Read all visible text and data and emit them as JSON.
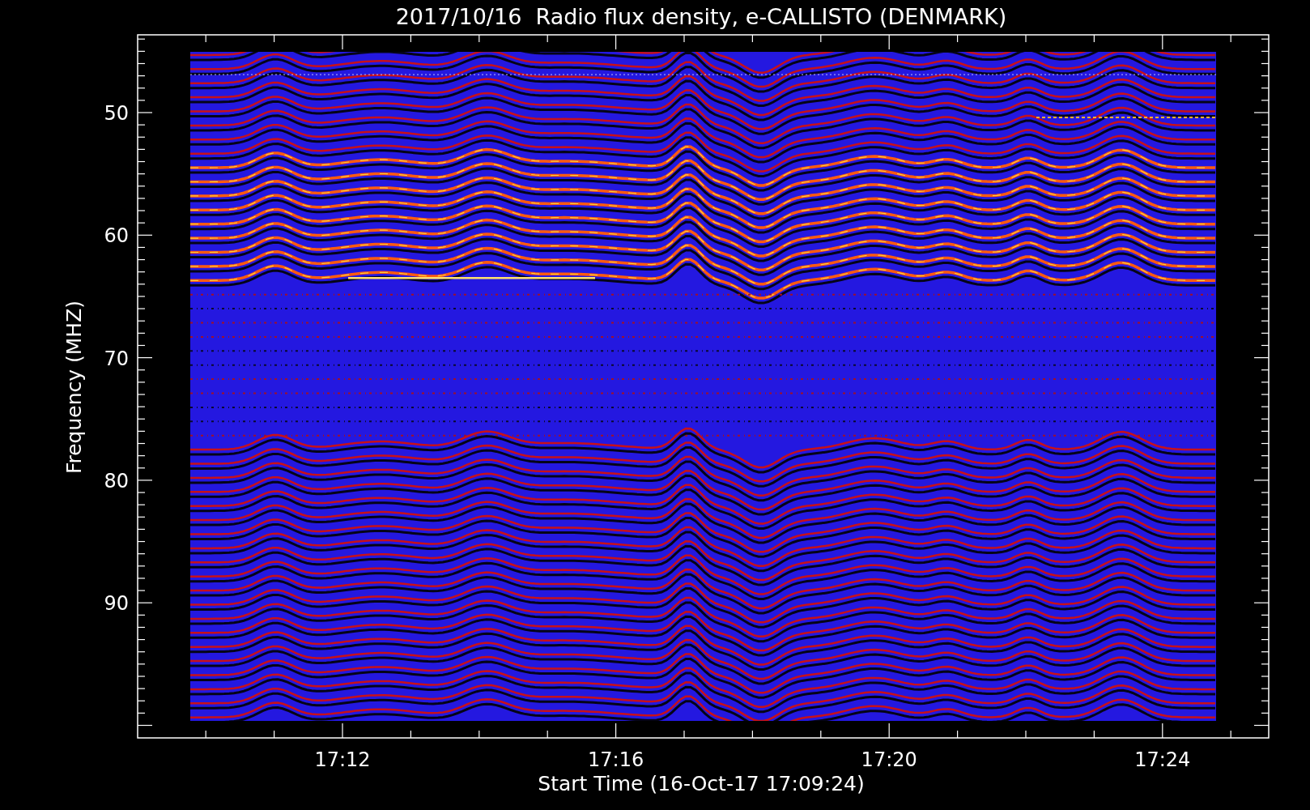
{
  "title": "2017/10/16  Radio flux density, e-CALLISTO (DENMARK)",
  "ylabel": "Frequency (MHZ)",
  "xlabel": "Start Time (16-Oct-17 17:09:24)",
  "y_ticks": [
    "50",
    "60",
    "70",
    "80",
    "90"
  ],
  "x_ticks": [
    "17:12",
    "17:16",
    "17:20",
    "17:24"
  ]
}
